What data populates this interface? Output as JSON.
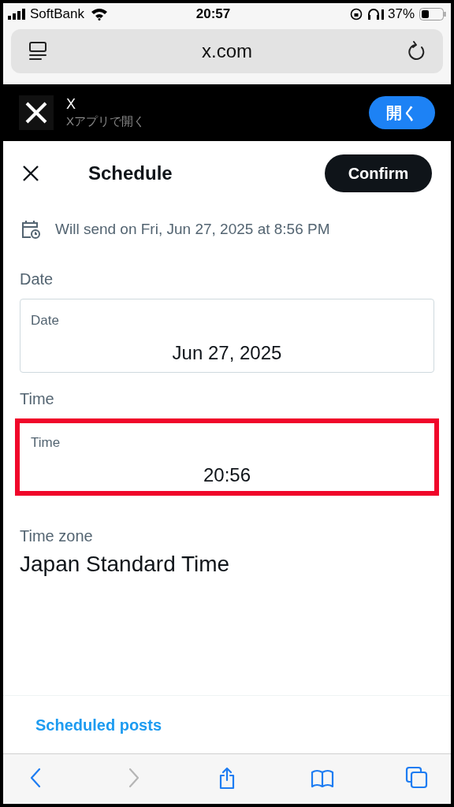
{
  "status_bar": {
    "carrier": "SoftBank",
    "time": "20:57",
    "battery": "37%"
  },
  "address_bar": {
    "url": "x.com"
  },
  "app_banner": {
    "name": "X",
    "subtitle": "Xアプリで開く",
    "button": "開く"
  },
  "header": {
    "title": "Schedule",
    "confirm": "Confirm"
  },
  "summary": "Will send on Fri, Jun 27, 2025 at 8:56 PM",
  "sections": [
    {
      "heading": "Date",
      "field_label": "Date",
      "value": "Jun 27, 2025",
      "highlighted": false
    },
    {
      "heading": "Time",
      "field_label": "Time",
      "value": "20:56",
      "highlighted": true
    }
  ],
  "time_zone": {
    "label": "Time zone",
    "value": "Japan Standard Time"
  },
  "footer_link": "Scheduled posts",
  "toolbar": [
    {
      "kind": "back",
      "disabled": false
    },
    {
      "kind": "forward",
      "disabled": true
    },
    {
      "kind": "share",
      "disabled": false
    },
    {
      "kind": "bookmarks",
      "disabled": false
    },
    {
      "kind": "tabs",
      "disabled": false
    }
  ]
}
